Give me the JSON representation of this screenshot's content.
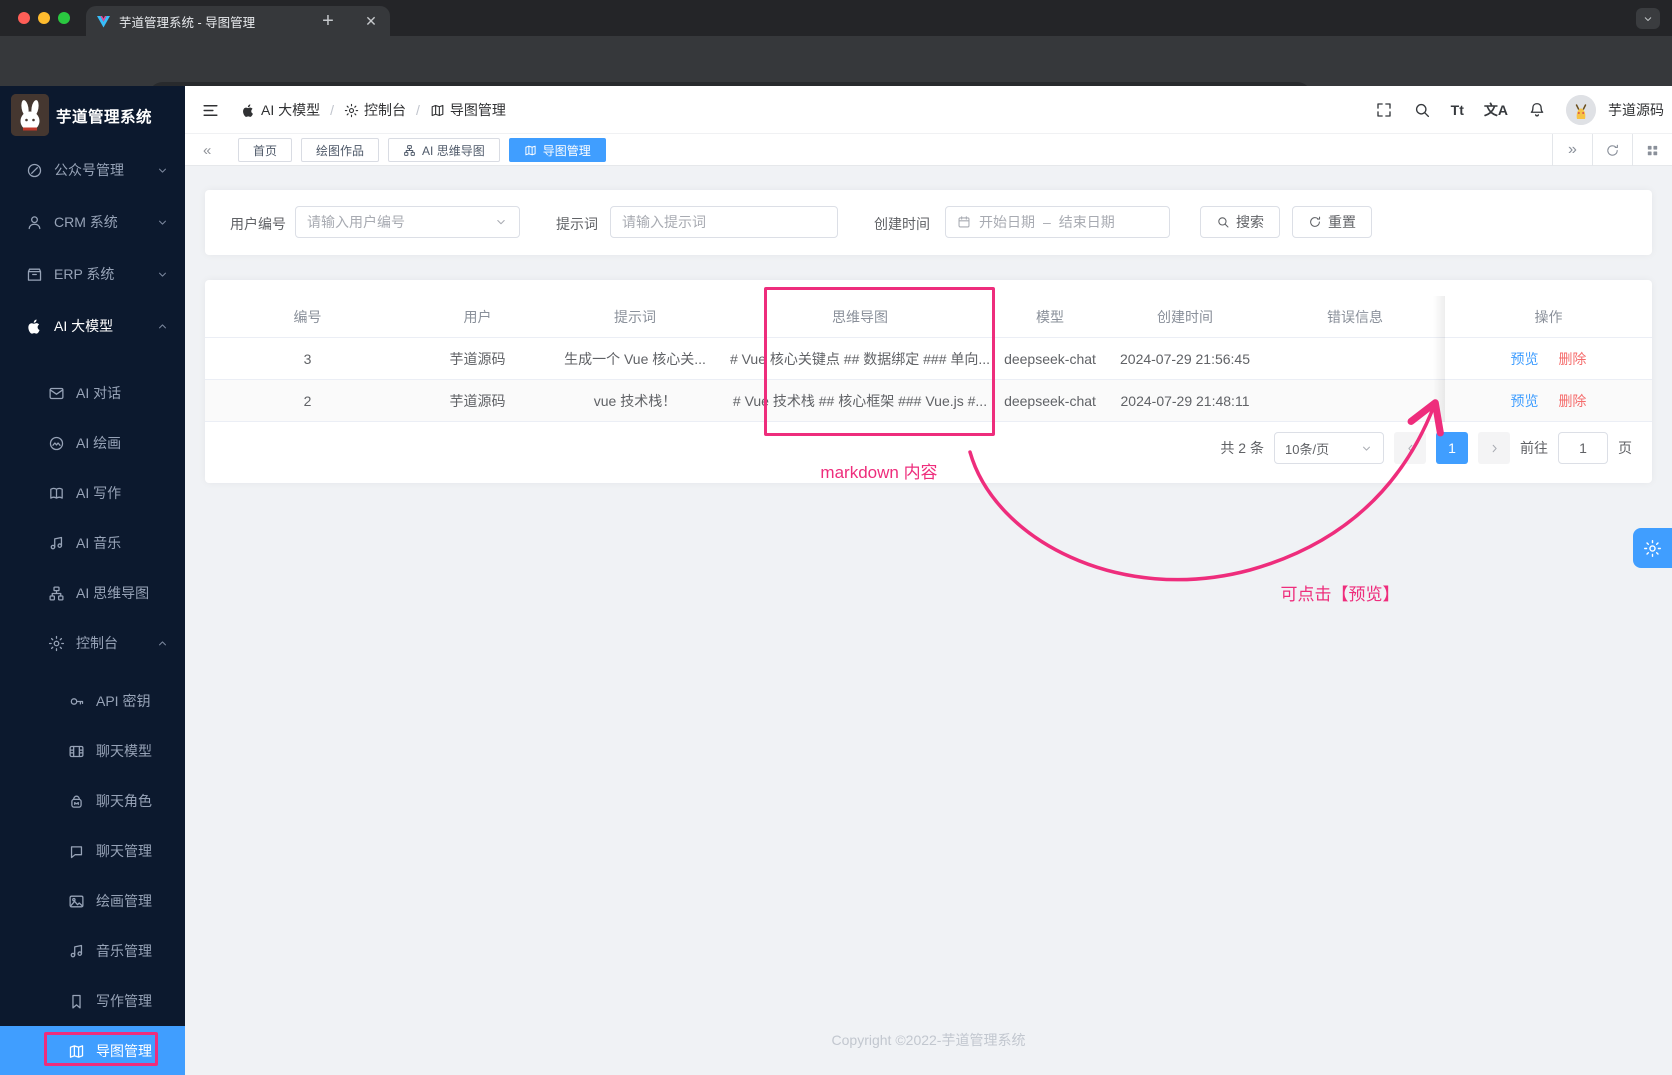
{
  "browser": {
    "tab_title": "芋道管理系统 - 导图管理",
    "url": "127.0.0.1/ai/console/mind-map"
  },
  "sidebar": {
    "logo_title": "芋道管理系统",
    "items": [
      {
        "label": "公众号管理",
        "icon": "compass-icon",
        "level": 1,
        "chevron": "down"
      },
      {
        "label": "CRM 系统",
        "icon": "user-icon",
        "level": 1,
        "chevron": "down"
      },
      {
        "label": "ERP 系统",
        "icon": "box-icon",
        "level": 1,
        "chevron": "down"
      },
      {
        "label": "AI 大模型",
        "icon": "apple-icon",
        "level": 1,
        "chevron": "up",
        "expanded": true
      },
      {
        "label": "AI 对话",
        "icon": "mail-icon",
        "level": 2
      },
      {
        "label": "AI 绘画",
        "icon": "paint-circle-icon",
        "level": 2
      },
      {
        "label": "AI 写作",
        "icon": "book-icon",
        "level": 2
      },
      {
        "label": "AI 音乐",
        "icon": "music-icon",
        "level": 2
      },
      {
        "label": "AI 思维导图",
        "icon": "sitemap-icon",
        "level": 2
      },
      {
        "label": "控制台",
        "icon": "gear-icon",
        "level": 2,
        "chevron": "up",
        "expanded": true
      },
      {
        "label": "API 密钥",
        "icon": "key-icon",
        "level": 3
      },
      {
        "label": "聊天模型",
        "icon": "film-icon",
        "level": 3
      },
      {
        "label": "聊天角色",
        "icon": "backpack-icon",
        "level": 3
      },
      {
        "label": "聊天管理",
        "icon": "chat-icon",
        "level": 3
      },
      {
        "label": "绘画管理",
        "icon": "picture-icon",
        "level": 3
      },
      {
        "label": "音乐管理",
        "icon": "music-icon",
        "level": 3
      },
      {
        "label": "写作管理",
        "icon": "bookmark-icon",
        "level": 3
      },
      {
        "label": "导图管理",
        "icon": "map-icon",
        "level": 3,
        "active": true
      }
    ]
  },
  "header": {
    "breadcrumb": [
      {
        "label": "AI 大模型",
        "icon": "apple-icon"
      },
      {
        "label": "控制台",
        "icon": "gear-icon"
      },
      {
        "label": "导图管理",
        "icon": "map-icon"
      }
    ],
    "font_tool": "Tt",
    "translate_tool": "文A",
    "user_name": "芋道源码"
  },
  "tabs": [
    {
      "label": "首页"
    },
    {
      "label": "绘图作品"
    },
    {
      "label": "AI 思维导图",
      "icon": "sitemap-icon"
    },
    {
      "label": "导图管理",
      "icon": "map-icon",
      "active": true
    }
  ],
  "filters": {
    "user_label": "用户编号",
    "user_placeholder": "请输入用户编号",
    "prompt_label": "提示词",
    "prompt_placeholder": "请输入提示词",
    "date_label": "创建时间",
    "date_start_placeholder": "开始日期",
    "date_separator": "–",
    "date_end_placeholder": "结束日期",
    "search_button": "搜索",
    "reset_button": "重置"
  },
  "table": {
    "columns": [
      "编号",
      "用户",
      "提示词",
      "思维导图",
      "模型",
      "创建时间",
      "错误信息",
      "操作"
    ],
    "rows": [
      {
        "id": "3",
        "user": "芋道源码",
        "prompt": "生成一个 Vue 核心关...",
        "mindmap": "# Vue 核心关键点 ## 数据绑定 ### 单向...",
        "model": "deepseek-chat",
        "created": "2024-07-29 21:56:45",
        "error": ""
      },
      {
        "id": "2",
        "user": "芋道源码",
        "prompt": "vue 技术栈！",
        "mindmap": "# Vue 技术栈 ## 核心框架 ### Vue.js #...",
        "model": "deepseek-chat",
        "created": "2024-07-29 21:48:11",
        "error": ""
      }
    ],
    "action_preview": "预览",
    "action_delete": "删除"
  },
  "pagination": {
    "total_text": "共 2 条",
    "page_size": "10条/页",
    "current_page": "1",
    "goto_label": "前往",
    "goto_value": "1",
    "page_unit": "页"
  },
  "annotations": {
    "mindmap_note": "markdown 内容",
    "preview_note": "可点击【预览】",
    "accent_color": "#ee2d7c"
  },
  "footer": {
    "copyright": "Copyright ©2022-芋道管理系统"
  },
  "colors": {
    "primary_blue": "#409eff",
    "sidebar_bg": "#0c192e",
    "delete_red": "#f56c6c",
    "annotation_pink": "#ee2d7c"
  }
}
